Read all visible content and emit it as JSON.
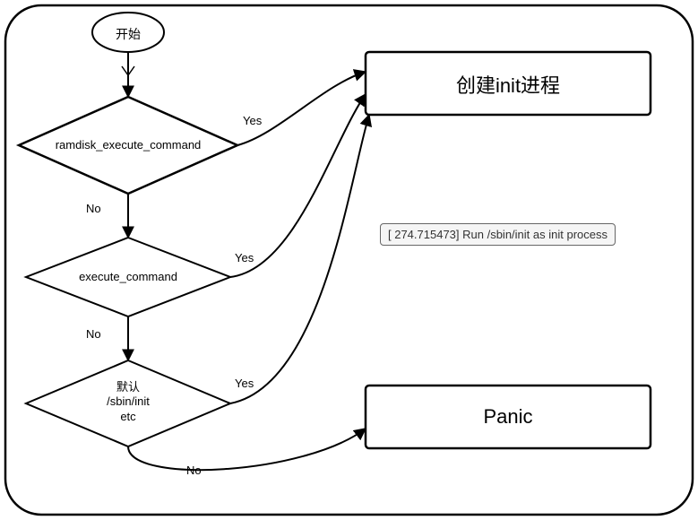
{
  "chart_data": {
    "type": "flowchart",
    "title": "",
    "nodes": [
      {
        "id": "start",
        "type": "terminator",
        "label": "开始"
      },
      {
        "id": "d1",
        "type": "decision",
        "label": "ramdisk_execute_command"
      },
      {
        "id": "d2",
        "type": "decision",
        "label": "execute_command"
      },
      {
        "id": "d3",
        "type": "decision",
        "label": "默认\n/sbin/init\netc"
      },
      {
        "id": "create_init",
        "type": "process",
        "label": "创建init进程"
      },
      {
        "id": "panic",
        "type": "process",
        "label": "Panic"
      },
      {
        "id": "log",
        "type": "annotation",
        "label": "[  274.715473] Run /sbin/init as init process"
      }
    ],
    "edges": [
      {
        "from": "start",
        "to": "d1",
        "label": ""
      },
      {
        "from": "d1",
        "to": "d2",
        "label": "No"
      },
      {
        "from": "d1",
        "to": "create_init",
        "label": "Yes"
      },
      {
        "from": "d2",
        "to": "d3",
        "label": "No"
      },
      {
        "from": "d2",
        "to": "create_init",
        "label": "Yes"
      },
      {
        "from": "d3",
        "to": "create_init",
        "label": "Yes"
      },
      {
        "from": "d3",
        "to": "panic",
        "label": "No"
      }
    ]
  },
  "labels": {
    "start": "开始",
    "d1": "ramdisk_execute_command",
    "d2": "execute_command",
    "d3_line1": "默认",
    "d3_line2": "/sbin/init",
    "d3_line3": "etc",
    "create_init": "创建init进程",
    "panic": "Panic",
    "log": "[  274.715473] Run /sbin/init as init process",
    "yes": "Yes",
    "no": "No"
  }
}
